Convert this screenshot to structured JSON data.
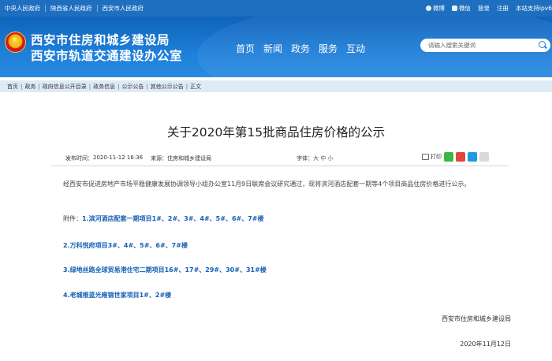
{
  "topbar": {
    "links": [
      "中央人民政府",
      "陕西省人民政府",
      "西安市人民政府"
    ],
    "weibo": "微博",
    "wechat": "微信",
    "login": "登录",
    "register": "注册",
    "ipv6": "本站支持ipv6"
  },
  "header": {
    "title1": "西安市住房和城乡建设局",
    "title2": "西安市轨道交通建设办公室",
    "nav": [
      "首页",
      "新闻",
      "政务",
      "服务",
      "互动"
    ],
    "search_placeholder": "请输入搜索关键词"
  },
  "breadcrumb": [
    "首页",
    "政务",
    "政府信息公开目录",
    "政务信息",
    "公示公告",
    "其他公示公告",
    "正文"
  ],
  "article": {
    "title": "关于2020年第15批商品住房价格的公示",
    "date_label": "发布时间：",
    "date": "2020-11-12 16:36",
    "source_label": "来源：",
    "source": "住房和城乡建设局",
    "fontsize_label": "字体：",
    "fontsize_options": "大 中 小",
    "print_label": "打印",
    "body": "经西安市促进房地产市场平稳健康发展协调领导小组办公室11月9日联席会议研究通过，现将滨河酒店配套一期等4个项目商品住房价格进行公示。",
    "attachment_label": "附件：",
    "attachments": [
      "1.滨河酒店配套一期项目1#、2#、3#、4#、5#、6#、7#楼",
      "2.万科悦府项目3#、4#、5#、6#、7#楼",
      "3.绿地丝路全球贸易港住宅二期项目16#、17#、29#、30#、31#楼",
      "4.老城根蓝光雍锦世家项目1#、2#楼"
    ],
    "signature": "西安市住房和城乡建设局",
    "sign_date": "2020年11月12日"
  },
  "colors": {
    "header_blue": "#1e7fd9",
    "topbar_blue": "#1f6fc0",
    "link_blue": "#1460b3",
    "breadcrumb_bg": "#dfeaf7"
  }
}
